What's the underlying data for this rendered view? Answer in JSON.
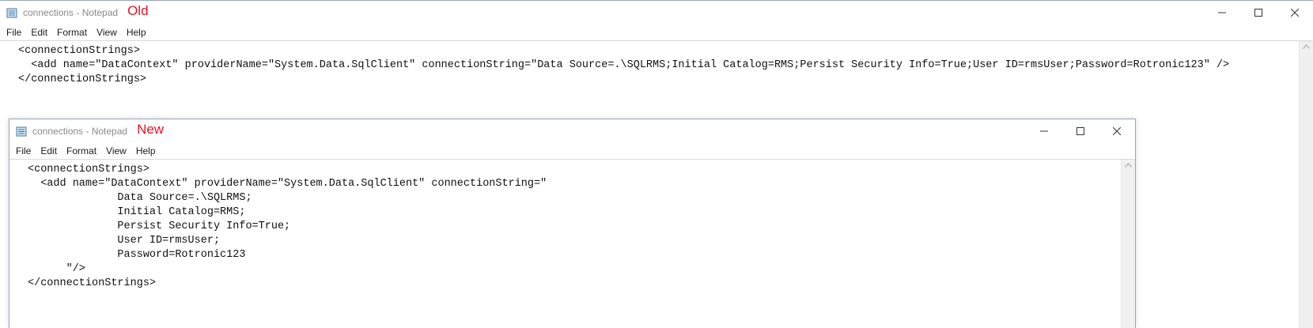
{
  "old_window": {
    "title": "connections - Notepad",
    "tag": "Old",
    "menu": [
      "File",
      "Edit",
      "Format",
      "View",
      "Help"
    ],
    "lines": [
      "<connectionStrings>",
      "  <add name=\"DataContext\" providerName=\"System.Data.SqlClient\" connectionString=\"Data Source=.\\SQLRMS;Initial Catalog=RMS;Persist Security Info=True;User ID=rmsUser;Password=Rotronic123\" />",
      "</connectionStrings>"
    ]
  },
  "new_window": {
    "title": "connections - Notepad",
    "tag": "New",
    "menu": [
      "File",
      "Edit",
      "Format",
      "View",
      "Help"
    ],
    "lines": [
      "<connectionStrings>",
      "  <add name=\"DataContext\" providerName=\"System.Data.SqlClient\" connectionString=\"",
      "              Data Source=.\\SQLRMS;",
      "              Initial Catalog=RMS;",
      "              Persist Security Info=True;",
      "              User ID=rmsUser;",
      "              Password=Rotronic123",
      "      \"/>",
      "</connectionStrings>"
    ]
  },
  "colors": {
    "tag": "#e81123",
    "title": "#8a8a8a"
  }
}
